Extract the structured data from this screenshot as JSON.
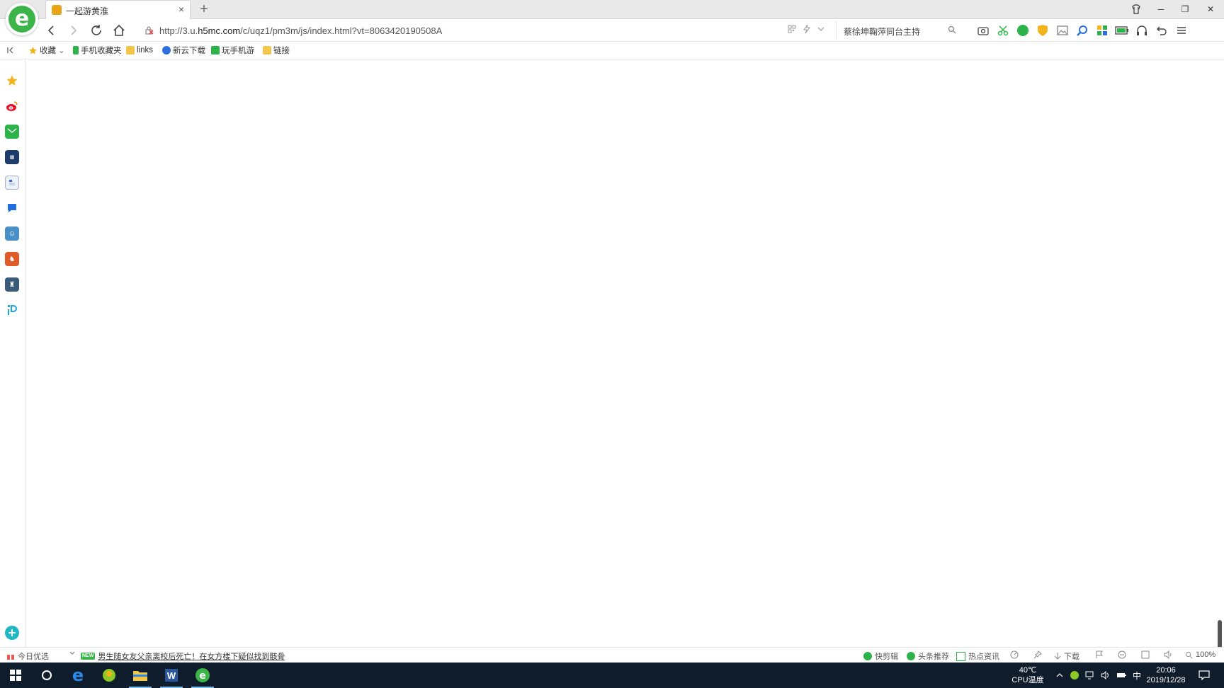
{
  "tab": {
    "title": "一起游黄淮",
    "close": "×",
    "new": "+"
  },
  "window": {
    "minimize": "─",
    "restore": "❐",
    "close": "✕"
  },
  "address": {
    "url_prefix": "http://3.u.",
    "url_domain": "h5mc.com",
    "url_suffix": "/c/uqz1/pm3m/js/index.html?vt=8063420190508A"
  },
  "search": {
    "query": "蔡徐坤鞠萍同台主持"
  },
  "bookmarks": [
    {
      "label": "收藏",
      "icon": "star-icon"
    },
    {
      "label": "手机收藏夹",
      "icon": "phone-icon"
    },
    {
      "label": "links",
      "icon": "folder-icon"
    },
    {
      "label": "新云下载",
      "icon": "globe-icon"
    },
    {
      "label": "玩手机游",
      "icon": "game-icon"
    },
    {
      "label": "链接",
      "icon": "folder-icon"
    }
  ],
  "statusbar": {
    "today": "今日优选",
    "new_badge": "NEW",
    "headline": "男生随女友父亲离校后死亡！在女方楼下疑似找到骸骨",
    "kuaijianji": "快剪辑",
    "toutiao": "头条推荐",
    "hot": "热点资讯",
    "download": "下载",
    "zoom": "100%"
  },
  "taskbar": {
    "temp": "40℃",
    "cpu": "CPU温度",
    "ime": "中",
    "time": "20:06",
    "date": "2019/12/28"
  },
  "colors": {
    "accent_green": "#3cb44a",
    "taskbar_bg": "#0f1c2c"
  }
}
